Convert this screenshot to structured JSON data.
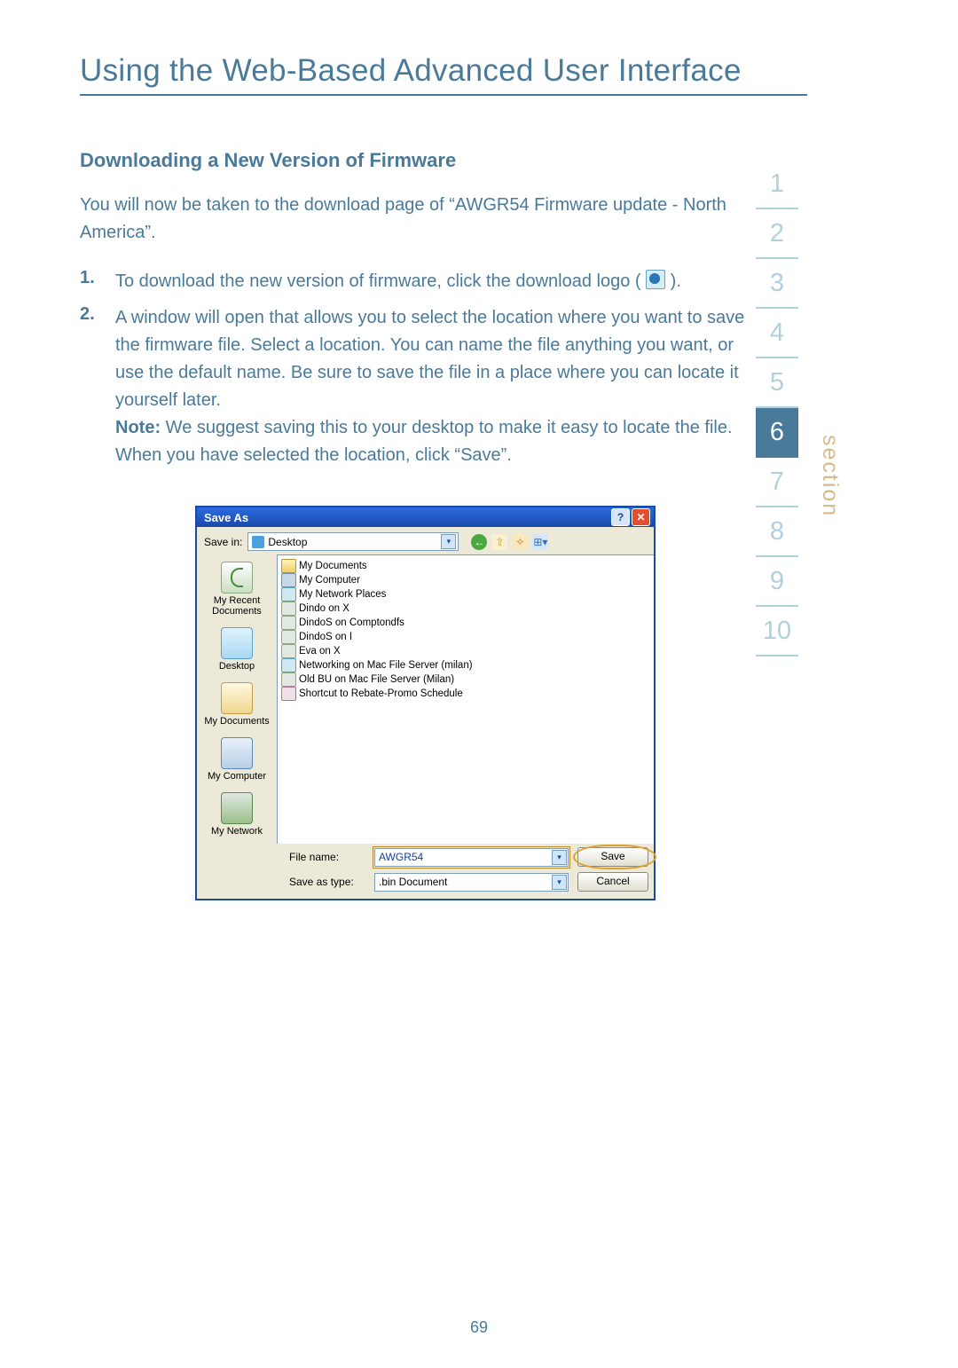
{
  "title": "Using the Web-Based Advanced User Interface",
  "subhead": "Downloading a New Version of Firmware",
  "intro": "You will now be taken to the download page of “AWGR54 Firmware update - North America”.",
  "steps": {
    "s1_num": "1.",
    "s1_a": "To download the new version of firmware, click the download logo (",
    "s1_b": ").",
    "s2_num": "2.",
    "s2_a": "A window will open that allows you to select the location where you want to save the firmware file. Select a location. You can name the file anything you want, or use the default name. Be sure to save the file in a place where you can locate it yourself later.",
    "s2_note_label": "Note:",
    "s2_note": " We suggest saving this to your desktop to make it easy to locate the file. When you have selected the location, click “Save”."
  },
  "section_label": "section",
  "tabs": [
    "1",
    "2",
    "3",
    "4",
    "5",
    "6",
    "7",
    "8",
    "9",
    "10"
  ],
  "active_tab": "6",
  "page_number": "69",
  "dialog": {
    "title": "Save As",
    "help": "?",
    "close": "✕",
    "savein_label": "Save in:",
    "savein_value": "Desktop",
    "tool_back": "←",
    "tool_up": "⇧",
    "tool_new": "✧",
    "tool_view": "⊞▾",
    "places": [
      {
        "label": "My Recent Documents",
        "icon": "pi-recent"
      },
      {
        "label": "Desktop",
        "icon": "pi-desktop"
      },
      {
        "label": "My Documents",
        "icon": "pi-docs"
      },
      {
        "label": "My Computer",
        "icon": "pi-comp"
      },
      {
        "label": "My Network",
        "icon": "pi-net"
      }
    ],
    "files": [
      {
        "icon": "fold",
        "name": "My Documents"
      },
      {
        "icon": "comp",
        "name": "My Computer"
      },
      {
        "icon": "net",
        "name": "My Network Places"
      },
      {
        "icon": "drv",
        "name": "Dindo on X"
      },
      {
        "icon": "drv",
        "name": "DindoS on Comptondfs"
      },
      {
        "icon": "drv",
        "name": "DindoS on I"
      },
      {
        "icon": "drv",
        "name": "Eva on X"
      },
      {
        "icon": "net",
        "name": "Networking on Mac File Server (milan)"
      },
      {
        "icon": "drv",
        "name": "Old BU on Mac File Server (Milan)"
      },
      {
        "icon": "sc",
        "name": "Shortcut to Rebate-Promo Schedule"
      }
    ],
    "filename_label": "File name:",
    "filename_value": "AWGR54",
    "saveas_label": "Save as type:",
    "saveas_value": ".bin Document",
    "save_btn": "Save",
    "cancel_btn": "Cancel",
    "dd": "▾"
  }
}
